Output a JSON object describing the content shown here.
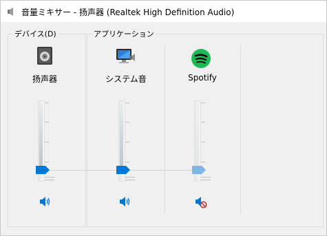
{
  "window": {
    "title": "音量ミキサー - 扬声器 (Realtek High Definition Audio)"
  },
  "devices_group": {
    "caption": "デバイス(D)"
  },
  "apps_group": {
    "caption": "アプリケーション"
  },
  "channels": [
    {
      "name": "扬声器",
      "icon": "speaker-device-icon",
      "volume_percent": 0,
      "muted": false,
      "mute_icon": "speaker-volume-icon"
    },
    {
      "name": "システム音",
      "icon": "system-sounds-icon",
      "volume_percent": 0,
      "muted": false,
      "mute_icon": "speaker-volume-icon"
    },
    {
      "name": "Spotify",
      "icon": "spotify-icon",
      "volume_percent": 0,
      "muted": true,
      "mute_icon": "speaker-muted-icon"
    }
  ],
  "colors": {
    "accent": "#0078d7",
    "thumb_disabled": "#7fb6e6",
    "spotify_green": "#1db954",
    "muted_red": "#d4282f"
  }
}
